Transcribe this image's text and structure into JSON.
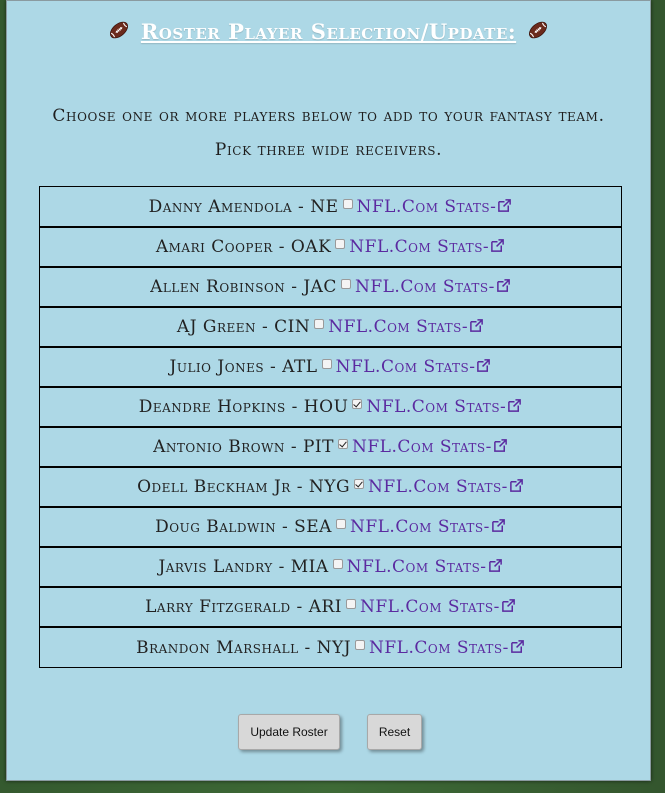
{
  "header": {
    "title": "Roster Player Selection/Update:",
    "left_icon": "football-icon",
    "right_icon": "football-icon"
  },
  "instructions": {
    "line1": "Choose one or more players below to add to your fantasy team.",
    "line2": "Pick three wide receivers."
  },
  "players": [
    {
      "label": "Danny Amendola - NE",
      "checked": false,
      "link": "NFL.Com Stats-"
    },
    {
      "label": "Amari Cooper - OAK",
      "checked": false,
      "link": "NFL.Com Stats-"
    },
    {
      "label": "Allen Robinson - JAC",
      "checked": false,
      "link": "NFL.Com Stats-"
    },
    {
      "label": "AJ Green - CIN",
      "checked": false,
      "link": "NFL.Com Stats-"
    },
    {
      "label": "Julio Jones - ATL",
      "checked": false,
      "link": "NFL.Com Stats-"
    },
    {
      "label": "Deandre Hopkins - HOU",
      "checked": true,
      "link": "NFL.Com Stats-"
    },
    {
      "label": "Antonio Brown - PIT",
      "checked": true,
      "link": "NFL.Com Stats-"
    },
    {
      "label": "Odell Beckham Jr - NYG",
      "checked": true,
      "link": "NFL.Com Stats-"
    },
    {
      "label": "Doug Baldwin - SEA",
      "checked": false,
      "link": "NFL.Com Stats-"
    },
    {
      "label": "Jarvis Landry - MIA",
      "checked": false,
      "link": "NFL.Com Stats-"
    },
    {
      "label": "Larry Fitzgerald - ARI",
      "checked": false,
      "link": "NFL.Com Stats-"
    },
    {
      "label": "Brandon Marshall - NYJ",
      "checked": false,
      "link": "NFL.Com Stats-"
    }
  ],
  "buttons": {
    "update_label": "Update Roster",
    "reset_label": "Reset"
  },
  "colors": {
    "panel_bg": "#add8e6",
    "link": "#5b2aa0",
    "title": "#ffffff"
  }
}
